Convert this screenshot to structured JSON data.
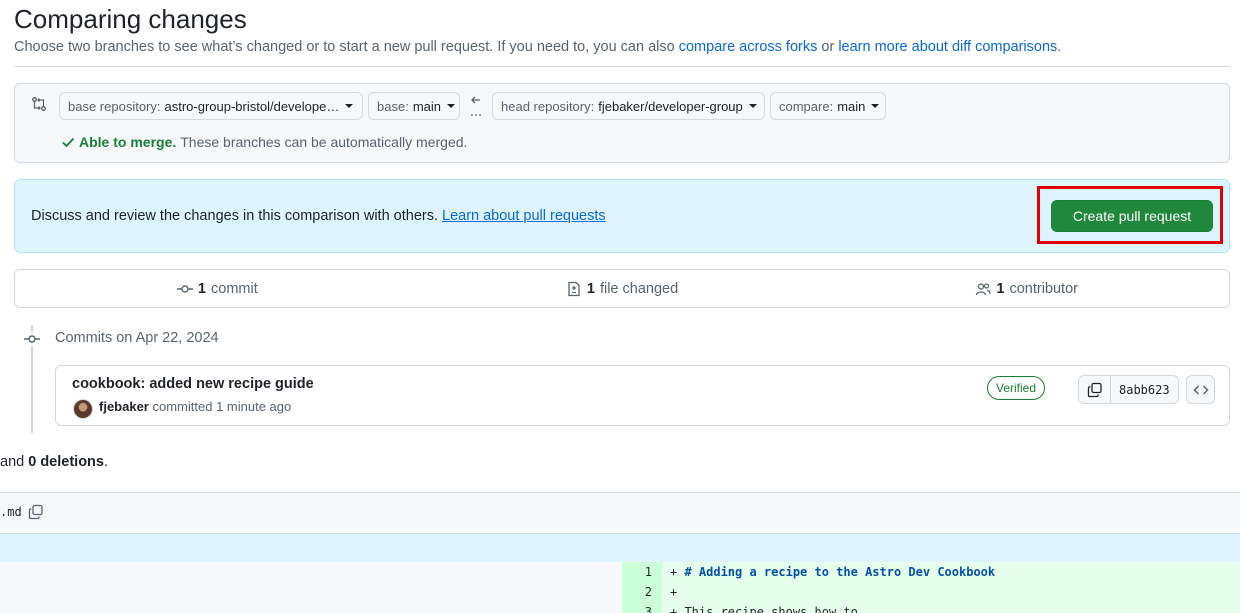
{
  "header": {
    "title": "Comparing changes",
    "subtitle_prefix": "Choose two branches to see what’s changed or to start a new pull request. If you need to, you can also",
    "link_forks": "compare across forks",
    "subtitle_or": "or",
    "link_learn": "learn more about diff comparisons",
    "subtitle_end": "."
  },
  "range": {
    "base_repo_label": "base repository:",
    "base_repo_value": "astro-group-bristol/develope…",
    "base_label": "base:",
    "base_value": "main",
    "head_repo_label": "head repository:",
    "head_repo_value": "fjebaker/developer-group",
    "compare_label": "compare:",
    "compare_value": "main",
    "merge_ok": "Able to merge.",
    "merge_text": "These branches can be automatically merged."
  },
  "pr_banner": {
    "text": "Discuss and review the changes in this comparison with others.",
    "link": "Learn about pull requests",
    "button": "Create pull request"
  },
  "stats": {
    "commits_count": "1",
    "commits_label": "commit",
    "files_count": "1",
    "files_label": "file changed",
    "contributors_count": "1",
    "contributors_label": "contributor"
  },
  "commits": {
    "date_heading": "Commits on Apr 22, 2024",
    "items": [
      {
        "title": "cookbook: added new recipe guide",
        "author": "fjebaker",
        "meta": "committed 1 minute ago",
        "badge": "Verified",
        "sha": "8abb623"
      }
    ]
  },
  "diff_summary": {
    "prefix": "and",
    "deletions": "0 deletions",
    "suffix": "."
  },
  "file": {
    "name": ".md"
  },
  "diff_lines": [
    {
      "num": "1",
      "prefix": "+ ",
      "text": "# Adding a recipe to the Astro Dev Cookbook",
      "heading": true
    },
    {
      "num": "2",
      "prefix": "+",
      "text": "",
      "heading": false
    },
    {
      "num": "3",
      "prefix": "+ ",
      "text": "This recipe shows how to",
      "heading": false
    }
  ],
  "colors": {
    "primary_button": "#1f883d",
    "link": "#0969da",
    "highlight_frame": "#e00000",
    "success": "#1a7f37"
  },
  "icons": [
    "git-compare-icon",
    "arrow-left-icon",
    "check-icon",
    "git-commit-icon",
    "file-diff-icon",
    "people-icon",
    "copy-icon",
    "code-icon"
  ]
}
